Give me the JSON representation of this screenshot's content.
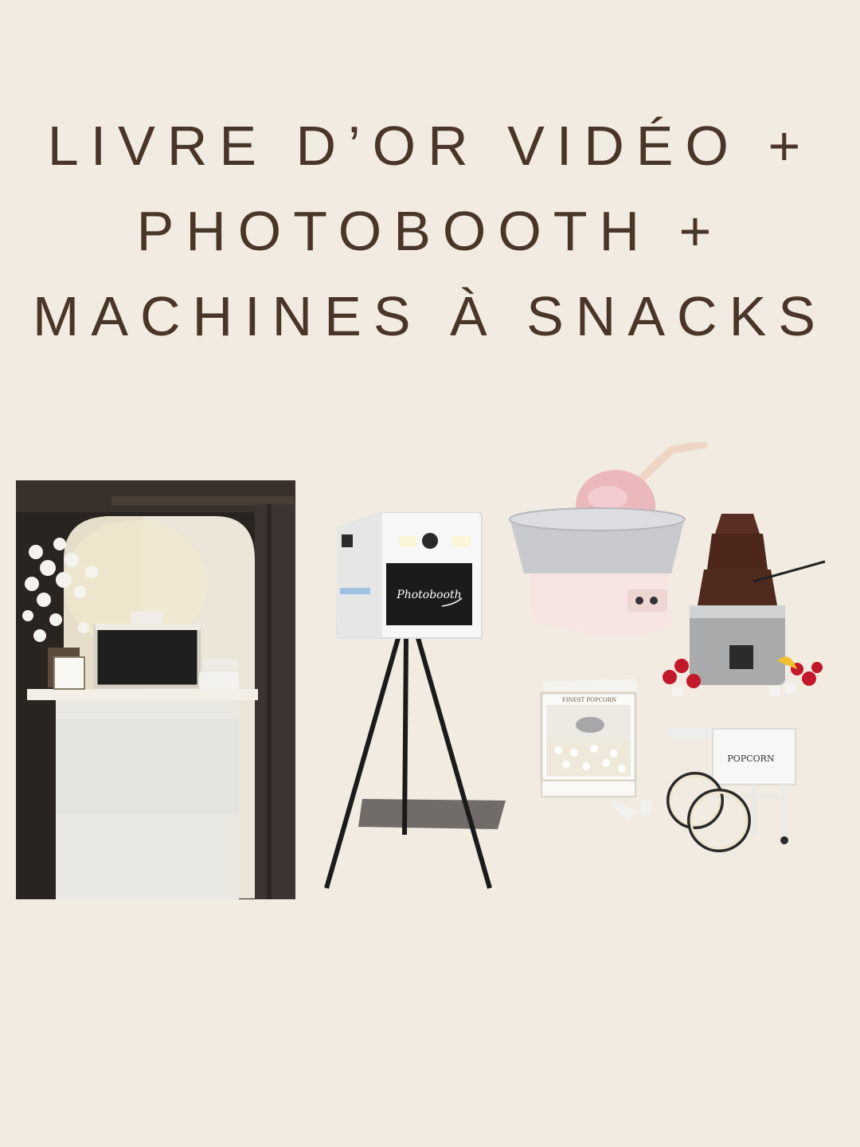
{
  "title": {
    "line1": "LIVRE D’OR VIDÉO +",
    "line2": "PHOTOBOOTH +",
    "line3": "MACHINES À SNACKS"
  },
  "photobooth_screen_text": "Photobooth",
  "popcorn_machine_label": "FINEST POPCORN",
  "popcorn_cart_label": "POPCORN",
  "colors": {
    "background": "#f1ebe1",
    "title_text": "#4a3529"
  }
}
